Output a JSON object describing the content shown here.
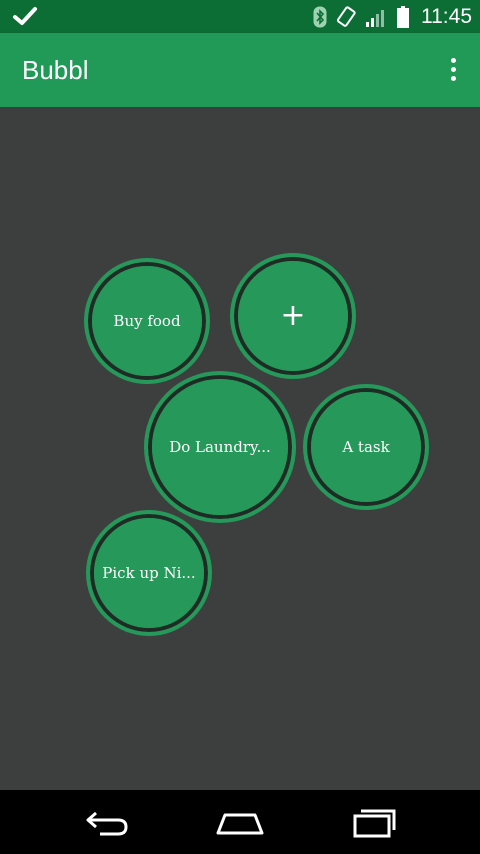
{
  "status_bar": {
    "time": "11:45",
    "icons": [
      "check-icon",
      "bluetooth-icon",
      "rotation-icon",
      "signal-icon",
      "battery-icon"
    ]
  },
  "app_bar": {
    "title": "Bubbl",
    "overflow_icon": "more-vert-icon"
  },
  "bubbles": [
    {
      "label": "Buy food"
    },
    {
      "label": "+",
      "icon": "add-icon"
    },
    {
      "label": "Do Laundry..."
    },
    {
      "label": "A task"
    },
    {
      "label": "Pick up Ni..."
    }
  ],
  "nav_bar": {
    "icons": [
      "back-icon",
      "home-icon",
      "recents-icon"
    ]
  },
  "colors": {
    "status_bar": "#0c6e35",
    "app_bar": "#219a57",
    "background": "#3d3f3e",
    "bubble": "#25985a",
    "bubble_ring": "#1f2c25"
  }
}
